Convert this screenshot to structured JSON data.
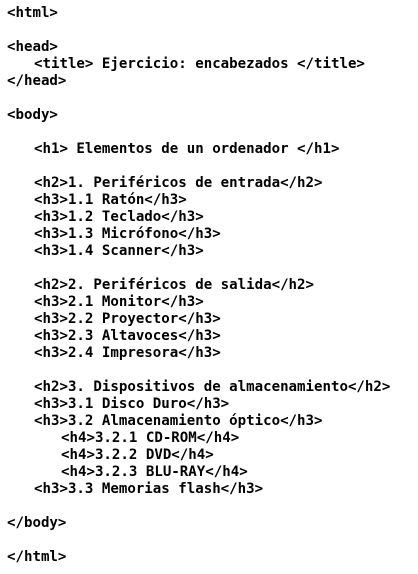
{
  "document": {
    "lines": [
      "<html>",
      "",
      "<head>",
      "<title> Ejercicio: encabezados </title>",
      "</head>",
      "",
      "<body>",
      "",
      "<h1> Elementos de un ordenador </h1>",
      "",
      "<h2>1. Periféricos de entrada</h2>",
      "<h3>1.1 Ratón</h3>",
      "<h3>1.2 Teclado</h3>",
      "<h3>1.3 Micrófono</h3>",
      "<h3>1.4 Scanner</h3>",
      "",
      "<h2>2. Periféricos de salida</h2>",
      "<h3>2.1 Monitor</h3>",
      "<h3>2.2 Proyector</h3>",
      "<h3>2.3 Altavoces</h3>",
      "<h3>2.4 Impresora</h3>",
      "",
      "<h2>3. Dispositivos de almacenamiento</h2>",
      "<h3>3.1 Disco Duro</h3>",
      "<h3>3.2 Almacenamiento óptico</h3>",
      "<h4>3.2.1 CD-ROM</h4>",
      "<h4>3.2.2 DVD</h4>",
      "<h4>3.2.3 BLU-RAY</h4>",
      "<h3>3.3 Memorias flash</h3>",
      "",
      "</body>",
      "",
      "</html>"
    ]
  }
}
